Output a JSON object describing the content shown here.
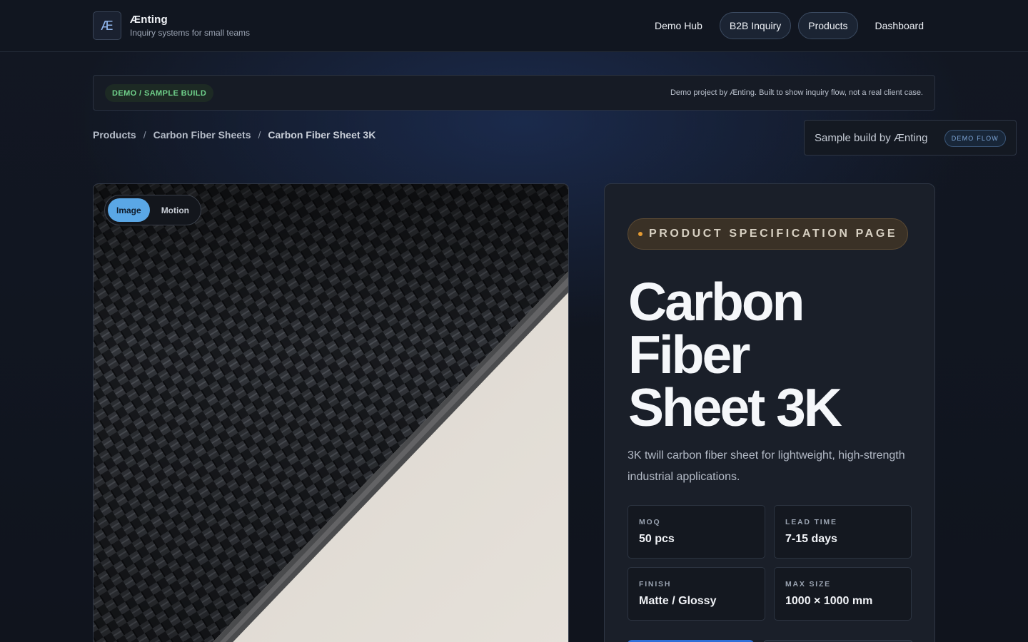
{
  "header": {
    "brand_mark": "Æ",
    "brand_name": "Ænting",
    "brand_tagline": "Inquiry systems for small teams",
    "nav": [
      {
        "label": "Demo Hub"
      },
      {
        "label": "B2B Inquiry"
      },
      {
        "label": "Products"
      },
      {
        "label": "Dashboard"
      }
    ]
  },
  "banner": {
    "badge": "DEMO / SAMPLE BUILD",
    "note": "Demo project by Ænting. Built to show inquiry flow, not a real client case."
  },
  "breadcrumb": {
    "items": [
      "Products",
      "Carbon Fiber Sheets",
      "Carbon Fiber Sheet 3K"
    ],
    "separator": "/"
  },
  "sample_chip": {
    "text": "Sample build by Ænting",
    "badge": "DEMO FLOW"
  },
  "media": {
    "toggle": [
      "Image",
      "Motion"
    ],
    "active": "Image"
  },
  "product": {
    "eyebrow": "PRODUCT SPECIFICATION PAGE",
    "title_lines": [
      "Carbon",
      "Fiber",
      "Sheet 3K"
    ],
    "description": "3K twill carbon fiber sheet for lightweight, high-strength industrial applications.",
    "specs": [
      {
        "label": "MOQ",
        "value": "50 pcs"
      },
      {
        "label": "LEAD TIME",
        "value": "7-15 days"
      },
      {
        "label": "FINISH",
        "value": "Matte / Glossy"
      },
      {
        "label": "MAX SIZE",
        "value": "1000 × 1000 mm"
      }
    ]
  },
  "colors": {
    "accent_blue": "#5aa7e6",
    "demo_green": "#6fd08a",
    "eyebrow_orange": "#e59b32",
    "cta_blue": "#2f6fd8"
  }
}
